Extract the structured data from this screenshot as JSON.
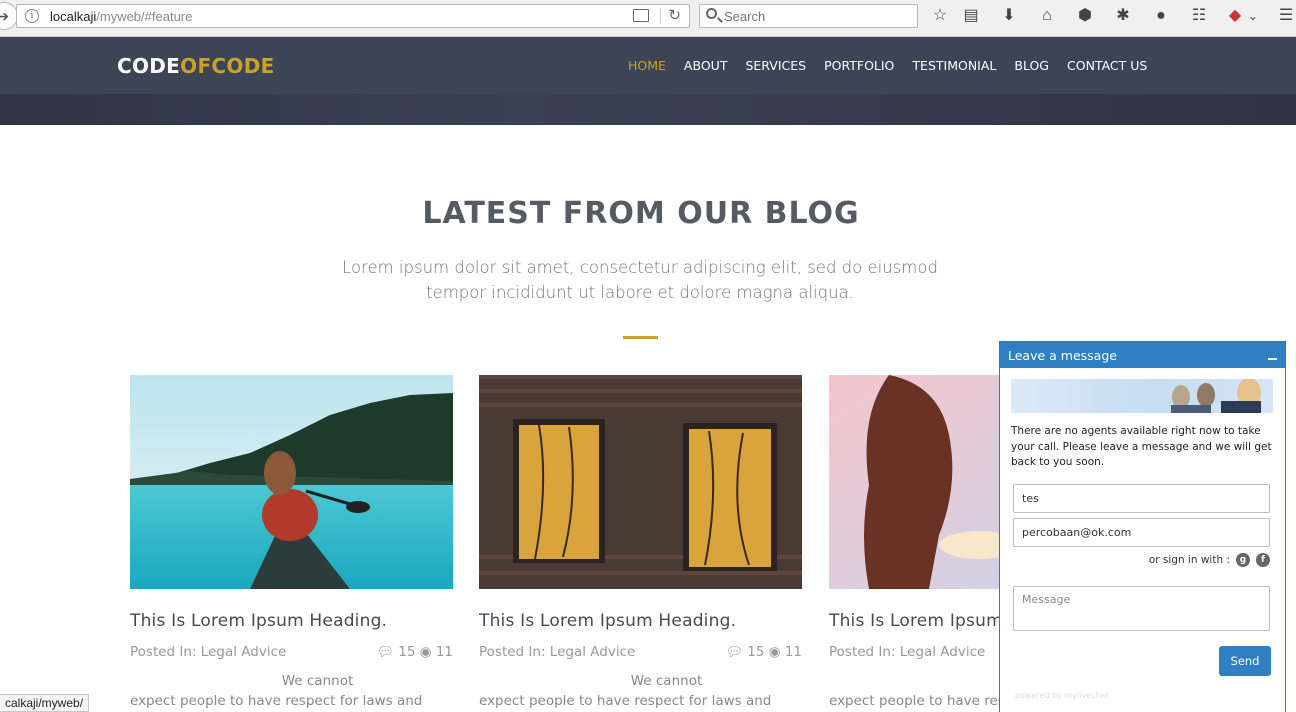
{
  "browser": {
    "url_host": "localkaji",
    "url_path": "/myweb/#feature",
    "search_placeholder": "Search",
    "status_url": "calkaji/myweb/"
  },
  "site": {
    "logo_part1": "CODE",
    "logo_part2": "OFCODE",
    "nav": [
      "HOME",
      "ABOUT",
      "SERVICES",
      "PORTFOLIO",
      "TESTIMONIAL",
      "BLOG",
      "CONTACT US"
    ],
    "active_nav": "HOME"
  },
  "blog": {
    "title": "LATEST FROM OUR BLOG",
    "subtitle_line1": "Lorem ipsum dolor sit amet, consectetur adipiscing elit, sed do eiusmod",
    "subtitle_line2": "tempor incididunt ut labore et dolore magna aliqua.",
    "cards": [
      {
        "heading": "This Is Lorem Ipsum Heading.",
        "posted_in": "Posted In: Legal Advice",
        "comments": "15",
        "views": "11",
        "excerpt_line1": "We cannot",
        "excerpt_line2": "expect people to have respect for laws and"
      },
      {
        "heading": "This Is Lorem Ipsum Heading.",
        "posted_in": "Posted In: Legal Advice",
        "comments": "15",
        "views": "11",
        "excerpt_line1": "We cannot",
        "excerpt_line2": "expect people to have respect for laws and"
      },
      {
        "heading": "This Is Lorem Ipsum Heading.",
        "posted_in": "Posted In: Legal Advice",
        "excerpt_line1": "We",
        "excerpt_line2": "expect people to have res"
      }
    ]
  },
  "chat": {
    "title": "Leave a message",
    "notice": "There are no agents available right now to take your call. Please leave a message and we will get back to you soon.",
    "name_value": "tes",
    "email_value": "percobaan@ok.com",
    "signin_label": "or sign in with :",
    "message_placeholder": "Message",
    "send_label": "Send",
    "powered": "powered by mylivechat"
  },
  "colors": {
    "accent": "#c9a227",
    "header_bg": "#3d4456",
    "chat_blue": "#2e80c2"
  }
}
